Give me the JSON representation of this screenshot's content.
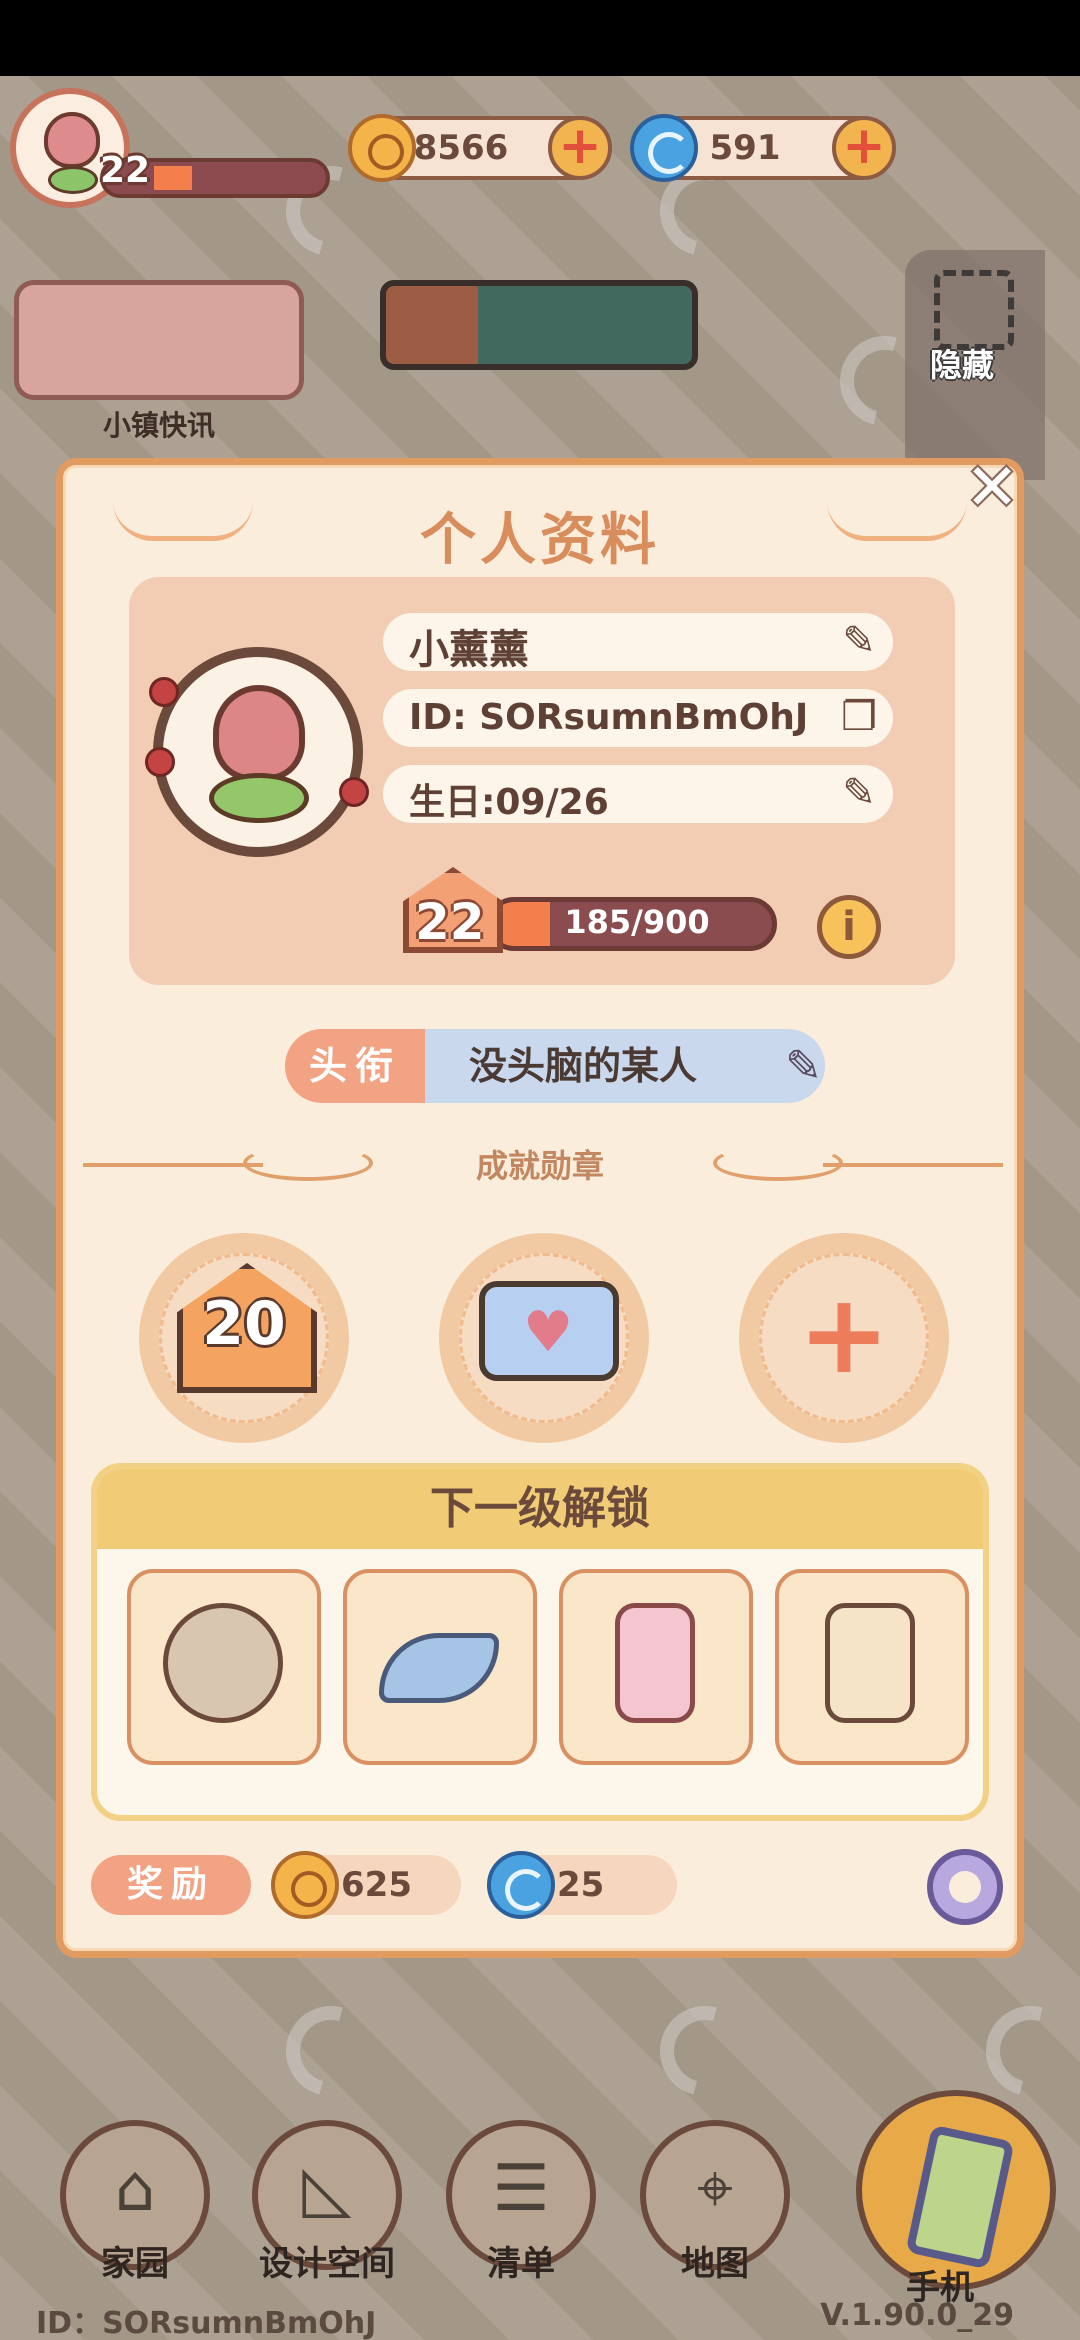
{
  "hud": {
    "player_level": "22",
    "gold": "8566",
    "gems": "591",
    "hide_label": "隐藏",
    "news_label": "小镇快讯"
  },
  "dialog": {
    "title": "个人资料",
    "close": "✕",
    "profile": {
      "name": "小薰薰",
      "id": "ID: SORsumnBmOhJ",
      "birthday": "生日:09/26",
      "level": "22",
      "xp": "185/900",
      "xp_fraction": 0.206,
      "info": "i"
    },
    "title_row": {
      "tag": "头衔",
      "value": "没头脑的某人"
    },
    "achievements": {
      "header": "成就勋章",
      "badge_1": "20"
    },
    "unlock": {
      "header": "下一级解锁"
    },
    "reward": {
      "tag": "奖励",
      "gold": "625",
      "gems": "25"
    }
  },
  "nav": {
    "home": "家园",
    "design": "设计空间",
    "list": "清单",
    "map": "地图",
    "phone": "手机"
  },
  "footer": {
    "id": "ID：SORsumnBmOhJ",
    "version": "V.1.90.0_29"
  },
  "colors": {
    "dialog_bg": "#fbeddb",
    "dialog_border": "#e19a5f",
    "accent_orange": "#f27f4c",
    "title_tag": "#f1a383",
    "title_value_bg": "#c9d8ec",
    "unlock_header": "#f1cb75"
  }
}
